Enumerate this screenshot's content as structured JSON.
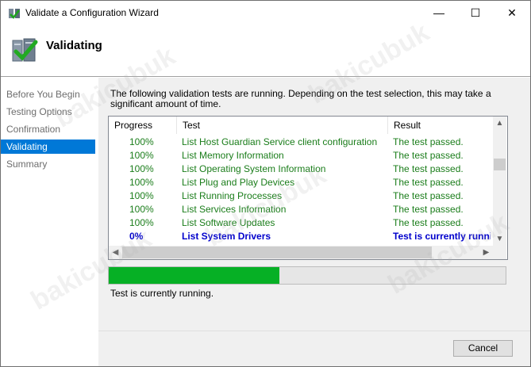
{
  "window": {
    "title": "Validate a Configuration Wizard"
  },
  "controls": {
    "minimize": "—",
    "maximize": "☐",
    "close": "✕"
  },
  "header": {
    "title": "Validating"
  },
  "nav": {
    "items": [
      {
        "label": "Before You Begin",
        "active": false
      },
      {
        "label": "Testing Options",
        "active": false
      },
      {
        "label": "Confirmation",
        "active": false
      },
      {
        "label": "Validating",
        "active": true
      },
      {
        "label": "Summary",
        "active": false
      }
    ]
  },
  "main": {
    "description": "The following validation tests are running. Depending on the test selection, this may take a significant amount of time.",
    "columns": {
      "progress": "Progress",
      "test": "Test",
      "result": "Result"
    },
    "rows": [
      {
        "progress": "100%",
        "test": "List Host Guardian Service client configuration",
        "result": "The test passed.",
        "status": "passed"
      },
      {
        "progress": "100%",
        "test": "List Memory Information",
        "result": "The test passed.",
        "status": "passed"
      },
      {
        "progress": "100%",
        "test": "List Operating System Information",
        "result": "The test passed.",
        "status": "passed"
      },
      {
        "progress": "100%",
        "test": "List Plug and Play Devices",
        "result": "The test passed.",
        "status": "passed"
      },
      {
        "progress": "100%",
        "test": "List Running Processes",
        "result": "The test passed.",
        "status": "passed"
      },
      {
        "progress": "100%",
        "test": "List Services Information",
        "result": "The test passed.",
        "status": "passed"
      },
      {
        "progress": "100%",
        "test": "List Software Updates",
        "result": "The test passed.",
        "status": "passed"
      },
      {
        "progress": "0%",
        "test": "List System Drivers",
        "result": "Test is currently running",
        "status": "running"
      }
    ],
    "overall_progress": 0.43,
    "status_text": "Test is currently running."
  },
  "footer": {
    "cancel_label": "Cancel"
  },
  "watermark": "bakicubuk",
  "colors": {
    "accent": "#0078d7",
    "passed": "#1a7d1a",
    "running": "#0000cc",
    "progress_fill": "#06b025"
  }
}
